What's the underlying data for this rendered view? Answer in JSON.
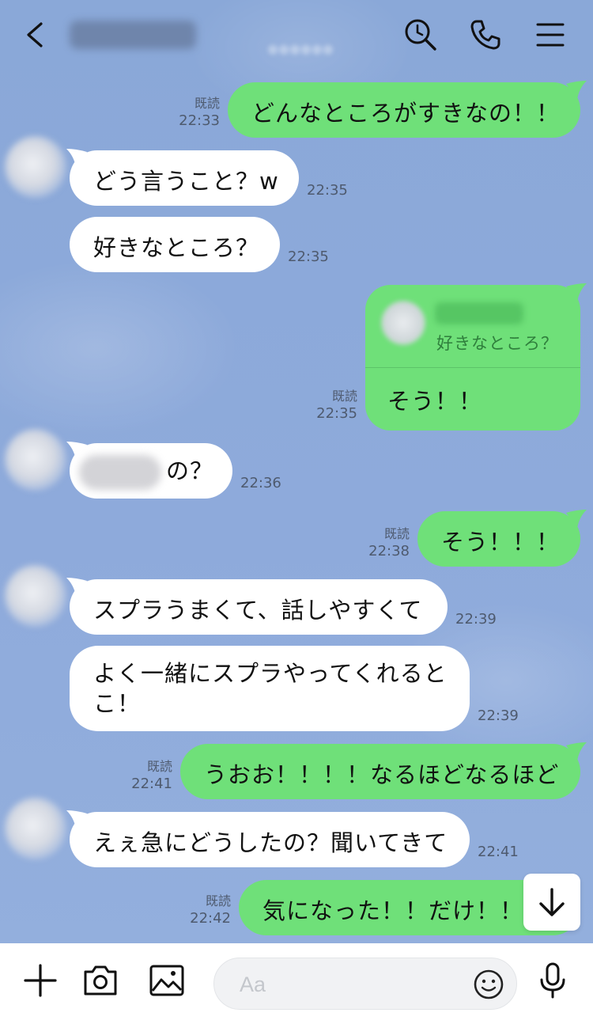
{
  "header": {
    "contact_name": "●●●● ●●",
    "subtitle": "●●●●●●",
    "back_icon": "chevron-left-icon",
    "search_icon": "search-icon",
    "call_icon": "phone-icon",
    "menu_icon": "menu-icon"
  },
  "colors": {
    "chat_background": "#8daad9",
    "outgoing_bubble": "#6fe079",
    "incoming_bubble": "#ffffff"
  },
  "messages": [
    {
      "dir": "out",
      "text": "どんなところがすきなの！！",
      "read": "既読",
      "time": "22:33"
    },
    {
      "dir": "in",
      "text": "どう言うこと？w",
      "time": "22:35"
    },
    {
      "dir": "in",
      "text": "好きなところ？",
      "time": "22:35"
    },
    {
      "dir": "out",
      "reply_quote": "好きなところ？",
      "text": "そう！！",
      "read": "既読",
      "time": "22:35"
    },
    {
      "dir": "in",
      "text": "の？",
      "time": "22:36"
    },
    {
      "dir": "out",
      "text": "そう！！！",
      "read": "既読",
      "time": "22:38"
    },
    {
      "dir": "in",
      "text": "スプラうまくて、話しやすくて",
      "time": "22:39"
    },
    {
      "dir": "in",
      "text_line1": "よく一緒にスプラやってくれると",
      "text_line2": "こ！",
      "time": "22:39"
    },
    {
      "dir": "out",
      "text": "うおお！！！！なるほどなるほど",
      "read": "既読",
      "time": "22:41"
    },
    {
      "dir": "in",
      "text": "えぇ急にどうしたの？聞いてきて",
      "time": "22:41"
    },
    {
      "dir": "out",
      "text": "気になった！！だけ！！",
      "read": "既読",
      "time": "22:42"
    }
  ],
  "input_bar": {
    "placeholder": "Aa",
    "plus_icon": "plus-icon",
    "camera_icon": "camera-icon",
    "image_icon": "image-icon",
    "emoji_icon": "emoji-icon",
    "mic_icon": "microphone-icon"
  },
  "scroll_down_icon": "arrow-down-icon"
}
